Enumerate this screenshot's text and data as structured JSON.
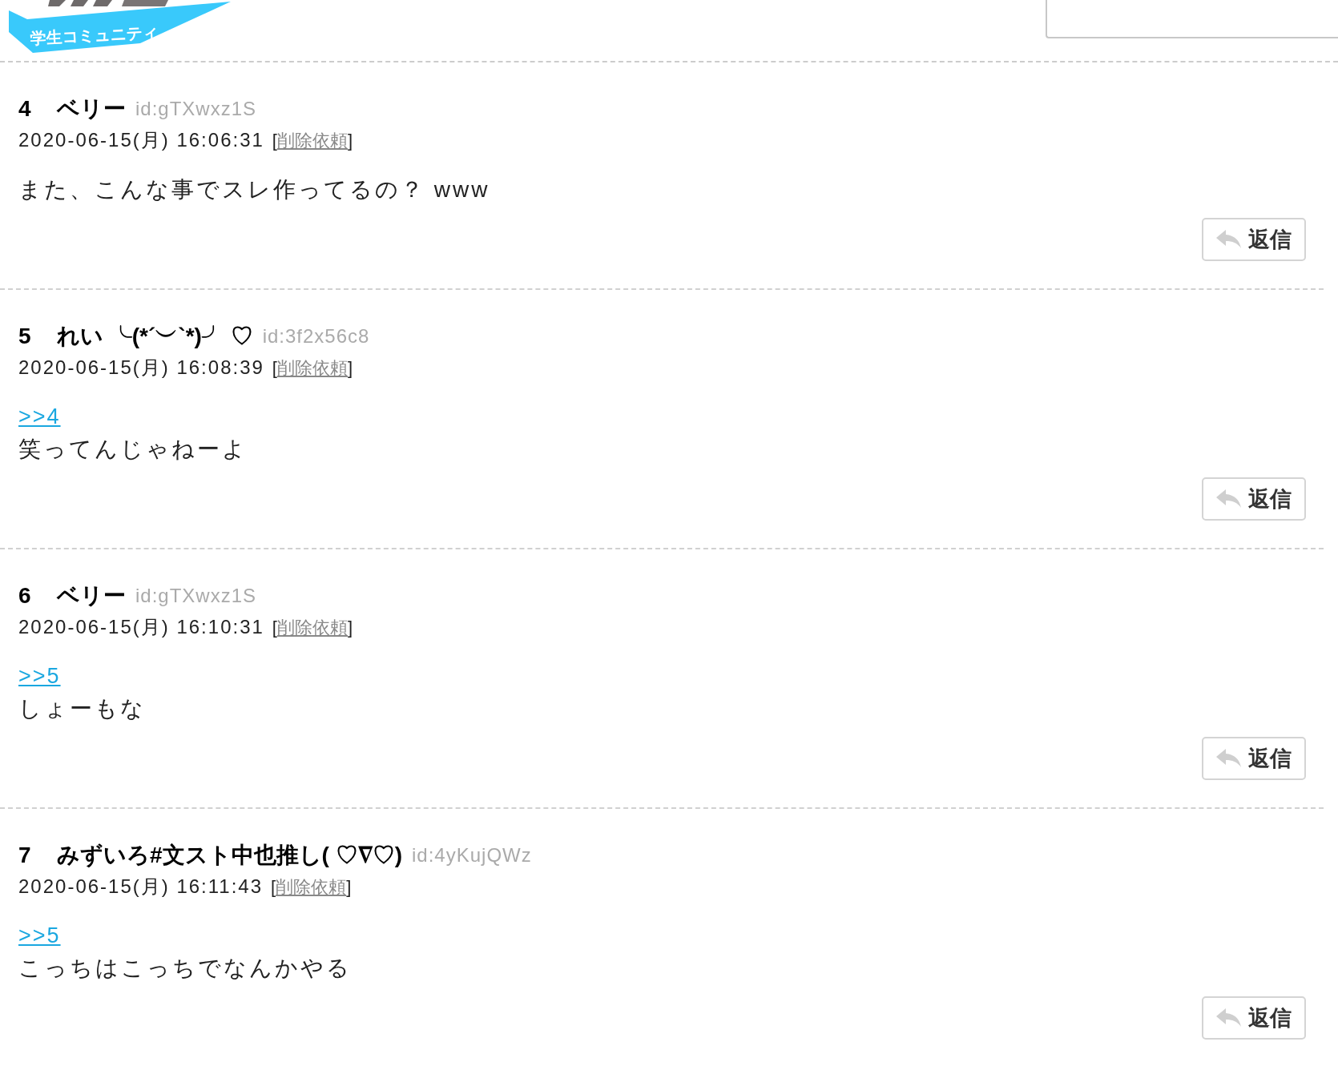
{
  "header": {
    "logo_tagline": "学生コミュニティ"
  },
  "posts": [
    {
      "number": "4",
      "name": "ベリー",
      "id": "id:gTXwxz1S",
      "datetime": "2020-06-15(月) 16:06:31",
      "delete_link": "[削除依頼]",
      "body": "また、こんな事でスレ作ってるの？ www",
      "reply": "返信"
    },
    {
      "number": "5",
      "name": "れい ╰(*´︶`*)╯ ♡",
      "id": "id:3f2x56c8",
      "datetime": "2020-06-15(月) 16:08:39",
      "delete_link": "[削除依頼]",
      "anchor": ">>4",
      "body": "笑ってんじゃねーよ",
      "reply": "返信"
    },
    {
      "number": "6",
      "name": "ベリー",
      "id": "id:gTXwxz1S",
      "datetime": "2020-06-15(月) 16:10:31",
      "delete_link": "[削除依頼]",
      "anchor": ">>5",
      "body": "しょーもな",
      "reply": "返信"
    },
    {
      "number": "7",
      "name": "みずいろ#文スト中也推し( ♡∇♡)",
      "id": "id:4yKujQWz",
      "datetime": "2020-06-15(月) 16:11:43",
      "delete_link": "[削除依頼]",
      "anchor": ">>5",
      "body": "こっちはこっちでなんかやる",
      "reply": "返信"
    }
  ]
}
